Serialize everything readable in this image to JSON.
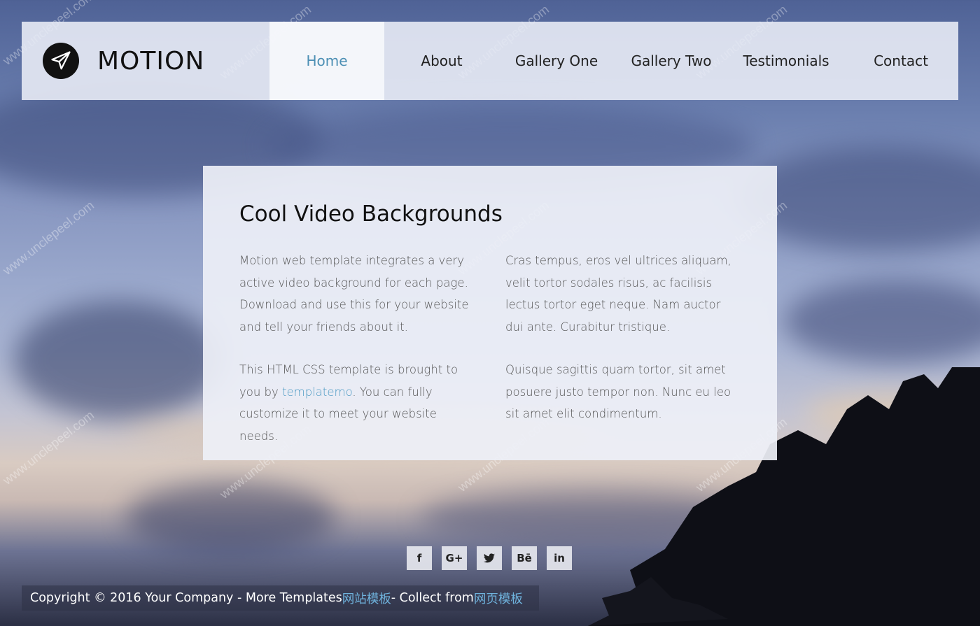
{
  "brand": {
    "name": "MOTION",
    "logo_icon": "paper-plane-icon"
  },
  "nav": {
    "items": [
      {
        "label": "Home",
        "active": true
      },
      {
        "label": "About",
        "active": false
      },
      {
        "label": "Gallery One",
        "active": false
      },
      {
        "label": "Gallery Two",
        "active": false
      },
      {
        "label": "Testimonials",
        "active": false
      },
      {
        "label": "Contact",
        "active": false
      }
    ]
  },
  "main": {
    "title": "Cool Video Backgrounds",
    "left": {
      "p1": "Motion web template integrates a very active video background for each page. Download and use this for your website and tell your friends about it.",
      "p2_before": "This HTML CSS template is brought to you by ",
      "p2_link": "templatemo",
      "p2_after": ". You can fully customize it to meet your website needs."
    },
    "right": {
      "p1": "Cras tempus, eros vel ultrices aliquam, velit tortor sodales risus, ac facilisis lectus tortor eget neque. Nam auctor dui ante. Curabitur tristique.",
      "p2": "Quisque sagittis quam tortor, sit amet posuere justo tempor non. Nunc eu leo sit amet elit condimentum."
    }
  },
  "social": [
    {
      "label": "f",
      "icon": "facebook-icon"
    },
    {
      "label": "G+",
      "icon": "google-plus-icon"
    },
    {
      "label": "twitter",
      "icon": "twitter-icon"
    },
    {
      "label": "Bē",
      "icon": "behance-icon"
    },
    {
      "label": "in",
      "icon": "linkedin-icon"
    }
  ],
  "footer": {
    "text1": "Copyright © 2016 Your Company - More Templates ",
    "link1": "网站模板",
    "text2": " - Collect from ",
    "link2": "网页模板"
  },
  "watermark": "www.unclepeel.com",
  "colors": {
    "accent": "#4c8fb4",
    "link": "#4c9ac4",
    "footer_link": "#6fb3dd"
  }
}
